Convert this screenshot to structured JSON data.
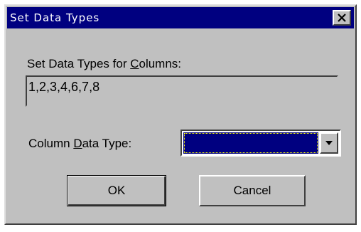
{
  "window": {
    "title": "Set Data Types",
    "close_icon": "close-icon"
  },
  "columns": {
    "label_prefix": "Set Data Types for ",
    "label_mnemonic": "C",
    "label_suffix": "olumns:",
    "value": "1,2,3,4,6,7,8"
  },
  "data_type": {
    "label_prefix": "Column ",
    "label_mnemonic": "D",
    "label_suffix": "ata Type:",
    "selected": "",
    "dropdown_icon": "chevron-down-icon"
  },
  "buttons": {
    "ok_label": "OK",
    "cancel_label": "Cancel"
  },
  "colors": {
    "dialog_face": "#c0c0c0",
    "titlebar": "#000080",
    "selection": "#000080"
  }
}
